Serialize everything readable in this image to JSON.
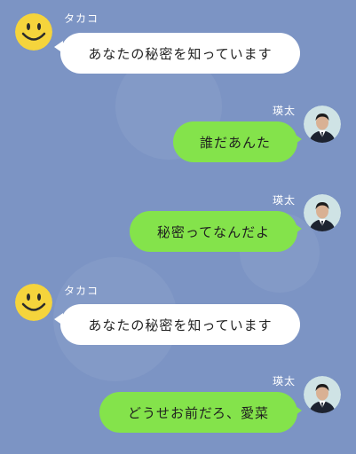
{
  "colors": {
    "background": "#7c94c4",
    "incoming_bubble": "#ffffff",
    "outgoing_bubble": "#84e34b",
    "smiley": "#f5d43c",
    "name_text": "#ffffff"
  },
  "messages": [
    {
      "sender": "タカコ",
      "text": "あなたの秘密を知っています",
      "side": "left",
      "avatar": "smiley-face-icon"
    },
    {
      "sender": "瑛太",
      "text": "誰だあんた",
      "side": "right",
      "avatar": "man-in-suit-avatar"
    },
    {
      "sender": "瑛太",
      "text": "秘密ってなんだよ",
      "side": "right",
      "avatar": "man-in-suit-avatar"
    },
    {
      "sender": "タカコ",
      "text": "あなたの秘密を知っています",
      "side": "left",
      "avatar": "smiley-face-icon"
    },
    {
      "sender": "瑛太",
      "text": "どうせお前だろ、愛菜",
      "side": "right",
      "avatar": "man-in-suit-avatar"
    }
  ]
}
